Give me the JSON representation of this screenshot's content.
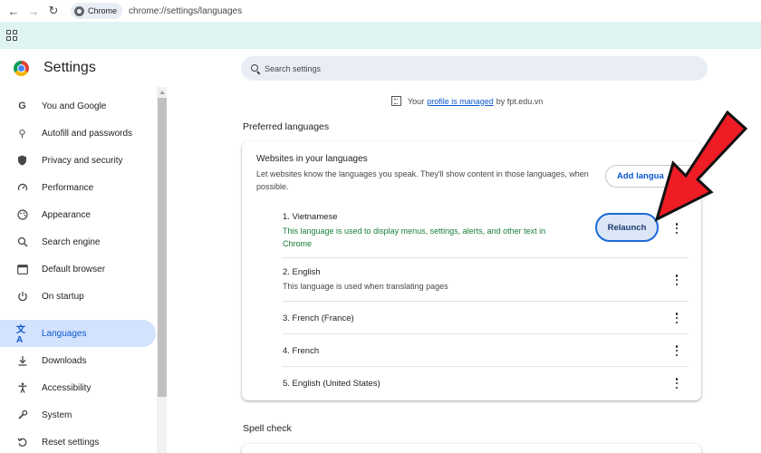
{
  "browser": {
    "back_icon": "arrow-left-icon",
    "forward_icon": "arrow-right-icon",
    "reload_icon": "reload-icon",
    "chip_label": "Chrome",
    "url": "chrome://settings/languages"
  },
  "header": {
    "title": "Settings",
    "search_placeholder": "Search settings"
  },
  "sidebar": {
    "items": [
      {
        "label": "You and Google",
        "icon": "google-g-icon"
      },
      {
        "label": "Autofill and passwords",
        "icon": "key-icon"
      },
      {
        "label": "Privacy and security",
        "icon": "shield-icon"
      },
      {
        "label": "Performance",
        "icon": "speedometer-icon"
      },
      {
        "label": "Appearance",
        "icon": "palette-icon"
      },
      {
        "label": "Search engine",
        "icon": "search-icon"
      },
      {
        "label": "Default browser",
        "icon": "browser-window-icon"
      },
      {
        "label": "On startup",
        "icon": "power-icon"
      },
      {
        "label": "Languages",
        "icon": "translate-icon",
        "active": true
      },
      {
        "label": "Downloads",
        "icon": "download-icon"
      },
      {
        "label": "Accessibility",
        "icon": "accessibility-icon"
      },
      {
        "label": "System",
        "icon": "wrench-icon"
      },
      {
        "label": "Reset settings",
        "icon": "reset-icon"
      }
    ]
  },
  "managed": {
    "prefix": "Your",
    "link": "profile is managed",
    "suffix": "by fpt.edu.vn"
  },
  "preferred": {
    "section_title": "Preferred languages",
    "card_title": "Websites in your languages",
    "card_desc": "Let websites know the languages you speak. They'll show content in those languages, when possible.",
    "add_button": "Add langua",
    "languages": [
      {
        "name": "1. Vietnamese",
        "sub": "This language is used to display menus, settings, alerts, and other text in Chrome",
        "relaunch": "Relaunch"
      },
      {
        "name": "2. English",
        "sub": "This language is used when translating pages"
      },
      {
        "name": "3. French (France)"
      },
      {
        "name": "4. French"
      },
      {
        "name": "5. English (United States)"
      }
    ]
  },
  "spell_check": {
    "section_title": "Spell check"
  },
  "colors": {
    "accent": "#0b57d0",
    "bookmark_bar": "#dff3f3",
    "active_nav": "#d3e3fd",
    "status_green": "#188038",
    "arrow_red": "#ee1c25"
  }
}
